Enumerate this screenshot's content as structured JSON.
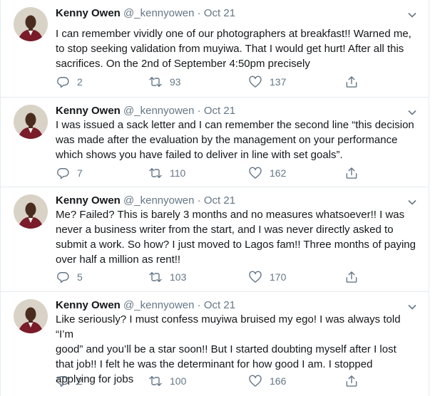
{
  "tweets": [
    {
      "name": "Kenny Owen",
      "handle": "@_kennyowen",
      "separator": "·",
      "date": "Oct 21",
      "text": "I can remember vividly one of our photographers at breakfast!! Warned me,\nto stop seeking validation from muyiwa. That I would get hurt! After all this\nsacrifices.  On the 2nd of September 4:50pm precisely",
      "replies": "2",
      "retweets": "93",
      "likes": "137"
    },
    {
      "name": "Kenny Owen",
      "handle": "@_kennyowen",
      "separator": "·",
      "date": "Oct 21",
      "text": "I was issued a sack letter and I can remember the second line “this decision\nwas made after the evaluation by the management on your performance\nwhich shows you have failed to deliver in line with set goals”.",
      "replies": "7",
      "retweets": "110",
      "likes": "162"
    },
    {
      "name": "Kenny Owen",
      "handle": "@_kennyowen",
      "separator": "·",
      "date": "Oct 21",
      "text": "Me? Failed? This is barely 3 months and no measures whatsoever!! I was\nnever a business writer from the start, and I was never directly asked to\nsubmit a work. So how? I just moved to Lagos fam!! Three months of paying\nover half a million as rent!!",
      "replies": "5",
      "retweets": "103",
      "likes": "170"
    },
    {
      "name": "Kenny Owen",
      "handle": "@_kennyowen",
      "separator": "·",
      "date": "Oct 21",
      "text": "Like seriously? I must confess muyiwa bruised my ego! I was always told “I’m\ngood” and you’ll be a star soon!! But I started doubting myself after I lost\nthat job!! I felt he was the determinant for how good I am. I stopped\napplying for jobs",
      "replies": "2",
      "retweets": "100",
      "likes": "166"
    }
  ],
  "colors": {
    "text": "#14171a",
    "secondary": "#657786",
    "divider": "#e6ecf0",
    "avatar_bg": "#d9d2c6",
    "jacket": "#7a1c2a"
  },
  "icons": [
    "chevron-down-icon",
    "reply-icon",
    "retweet-icon",
    "like-icon",
    "share-icon"
  ]
}
